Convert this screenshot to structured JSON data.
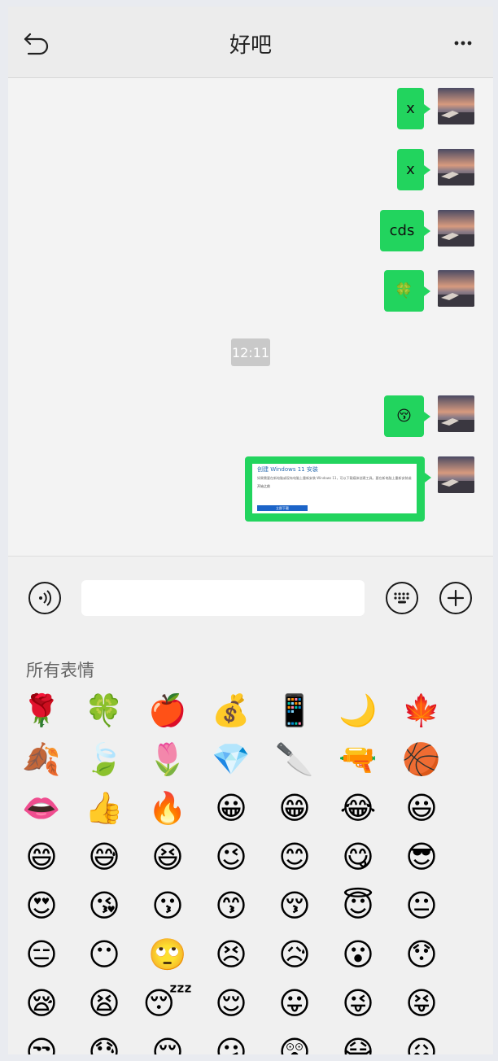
{
  "header": {
    "title": "好吧"
  },
  "messages": [
    {
      "text": "x"
    },
    {
      "text": "x"
    },
    {
      "text": "cds"
    },
    {
      "text": "🍀"
    },
    {
      "text": "😚"
    }
  ],
  "timestamp": "12:11",
  "card": {
    "title": "创建 Windows 11 安装",
    "body": "如果需要在新电脑或现有电脑上重新安装 Windows 11，可以下载媒体创建工具。要在新电脑上重新安装或创建",
    "link": "开始之前",
    "button": "立即下载"
  },
  "input": {
    "placeholder": ""
  },
  "panel": {
    "title": "所有表情"
  },
  "emoji_rows": [
    [
      "🌹",
      "🍀",
      "🍎",
      "💰",
      "📱",
      "🌙",
      "🍁"
    ],
    [
      "🍂",
      "🍃",
      "🌷",
      "💎",
      "🔪",
      "🔫",
      "🏀"
    ],
    [
      "👄",
      "👍",
      "🔥",
      "😀",
      "😁",
      "😂",
      "😃"
    ],
    [
      "😄",
      "😅",
      "😆",
      "😉",
      "😊",
      "😋",
      "😎"
    ],
    [
      "😍",
      "😘",
      "😗",
      "😙",
      "😚",
      "😇",
      "😐"
    ],
    [
      "😑",
      "😶",
      "🙄",
      "😣",
      "😥",
      "😮",
      "😯"
    ],
    [
      "😪",
      "😫",
      "😴",
      "😌",
      "😛",
      "😜",
      "😝"
    ],
    [
      "😒",
      "😓",
      "😔",
      "😕",
      "😲",
      "😷",
      "😖"
    ]
  ],
  "colors": {
    "bubble": "#22d45e",
    "emoji_face": "#f8b93a",
    "button": "#1c64c8"
  },
  "icons": [
    "back-icon",
    "more-icon",
    "voice-icon",
    "keyboard-icon",
    "add-icon"
  ]
}
